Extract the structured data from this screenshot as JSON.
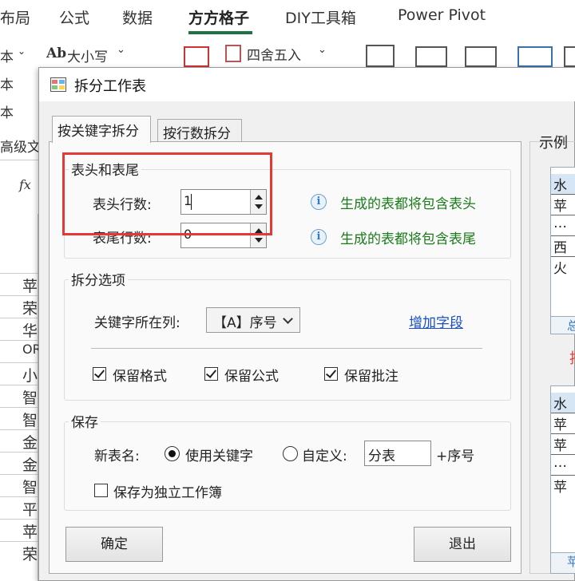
{
  "ribbon": {
    "tabs": [
      "布局",
      "公式",
      "数据",
      "方方格子",
      "DIY工具箱",
      "Power Pivot"
    ],
    "active_tab": "方方格子",
    "row1": {
      "case_btn": "大小写",
      "case_prefix": "Ab",
      "round_btn": "四舍五入",
      "left_stub": "本"
    },
    "row2": {
      "left_stub": "本"
    },
    "row3": {
      "left_stub": "本"
    },
    "row4": {
      "left_stub": "高级文"
    },
    "fx": "fx"
  },
  "sheet": {
    "cells": [
      "苹",
      "荣",
      "华",
      "OR",
      "小",
      "智",
      "智",
      "金",
      "金",
      "智",
      "平",
      "苹",
      "荣"
    ]
  },
  "dialog": {
    "title": "拆分工作表",
    "tabs": [
      "按关键字拆分",
      "按行数拆分"
    ],
    "header_footer": {
      "title": "表头和表尾",
      "header_rows_label": "表头行数:",
      "header_rows_value": "1",
      "footer_rows_label": "表尾行数:",
      "footer_rows_value": "0",
      "hint_header": "生成的表都将包含表头",
      "hint_footer": "生成的表都将包含表尾",
      "info_glyph": "i"
    },
    "split_options": {
      "title": "拆分选项",
      "key_col_label": "关键字所在列:",
      "key_col_value": "【A】序号",
      "add_field_link": "增加字段",
      "keep_format": "保留格式",
      "keep_formula": "保留公式",
      "keep_comment": "保留批注"
    },
    "save": {
      "title": "保存",
      "new_name_label": "新表名:",
      "use_keyword": "使用关键字",
      "custom": "自定义:",
      "custom_value": "分表",
      "suffix": "+序号",
      "save_as_workbook": "保存为独立工作簿"
    },
    "ok": "确定",
    "exit": "退出",
    "example": {
      "label": "示例",
      "top_cells": [
        "水",
        "苹",
        "…",
        "西",
        "火"
      ],
      "mid_text": "按",
      "bottom_cells": [
        "水",
        "苹",
        "苹",
        "…",
        "苹"
      ],
      "stub_top": "总",
      "stub_bottom": "苹"
    }
  }
}
